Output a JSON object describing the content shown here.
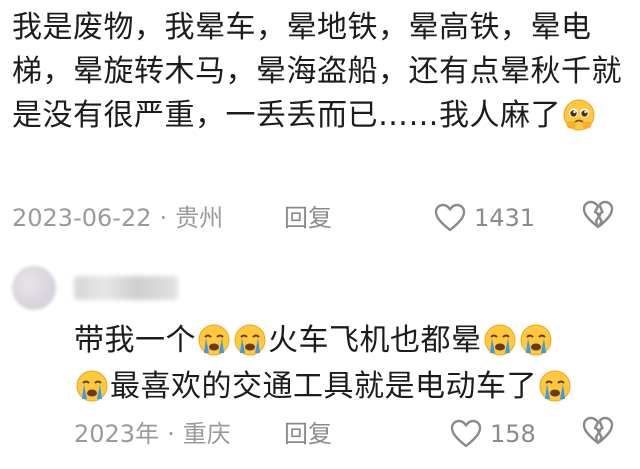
{
  "comment1": {
    "text": "我是废物，我晕车，晕地铁，晕高铁，晕电梯，晕旋转木马，晕海盗船，还有点晕秋千就是没有很严重，一丢丢而已……我人麻了",
    "date": "2023-06-22",
    "location": "贵州",
    "reply_label": "回复",
    "likes": "1431",
    "trailing_emoji": "pleading-face"
  },
  "comment2": {
    "text_a": "带我一个",
    "text_b": "火车飞机也都晕",
    "text_c": "最喜欢的交通工具就是电动车了",
    "emoji_name": "loudly-crying-face",
    "date": "2023年",
    "location": "重庆",
    "reply_label": "回复",
    "likes": "158"
  },
  "separator": "·",
  "colors": {
    "meta_gray": "#9a9a9a",
    "text": "#1c1c1c",
    "emoji_yellow": "#FFC83D",
    "tear_blue": "#3A9BE8"
  }
}
